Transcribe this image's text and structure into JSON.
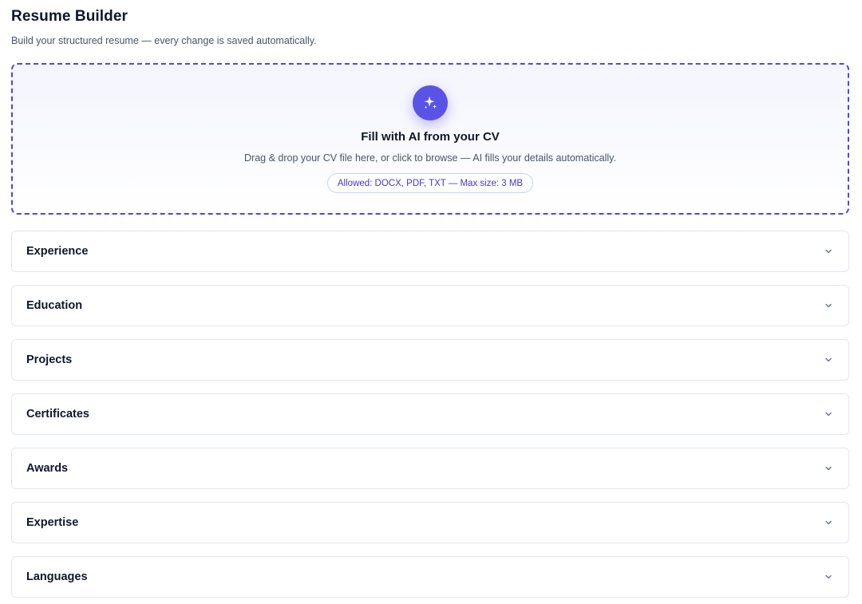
{
  "header": {
    "title": "Resume Builder",
    "subtitle": "Build your structured resume — every change is saved automatically."
  },
  "upload": {
    "icon": "sparkles-icon",
    "title": "Fill with AI from your CV",
    "description": "Drag & drop your CV file here, or click to browse — AI fills your details automatically.",
    "allowed": "Allowed: DOCX, PDF, TXT — Max size: 3 MB",
    "accent_color": "#4f46e5"
  },
  "sections": [
    {
      "label": "Experience"
    },
    {
      "label": "Education"
    },
    {
      "label": "Projects"
    },
    {
      "label": "Certificates"
    },
    {
      "label": "Awards"
    },
    {
      "label": "Expertise"
    },
    {
      "label": "Languages"
    }
  ]
}
